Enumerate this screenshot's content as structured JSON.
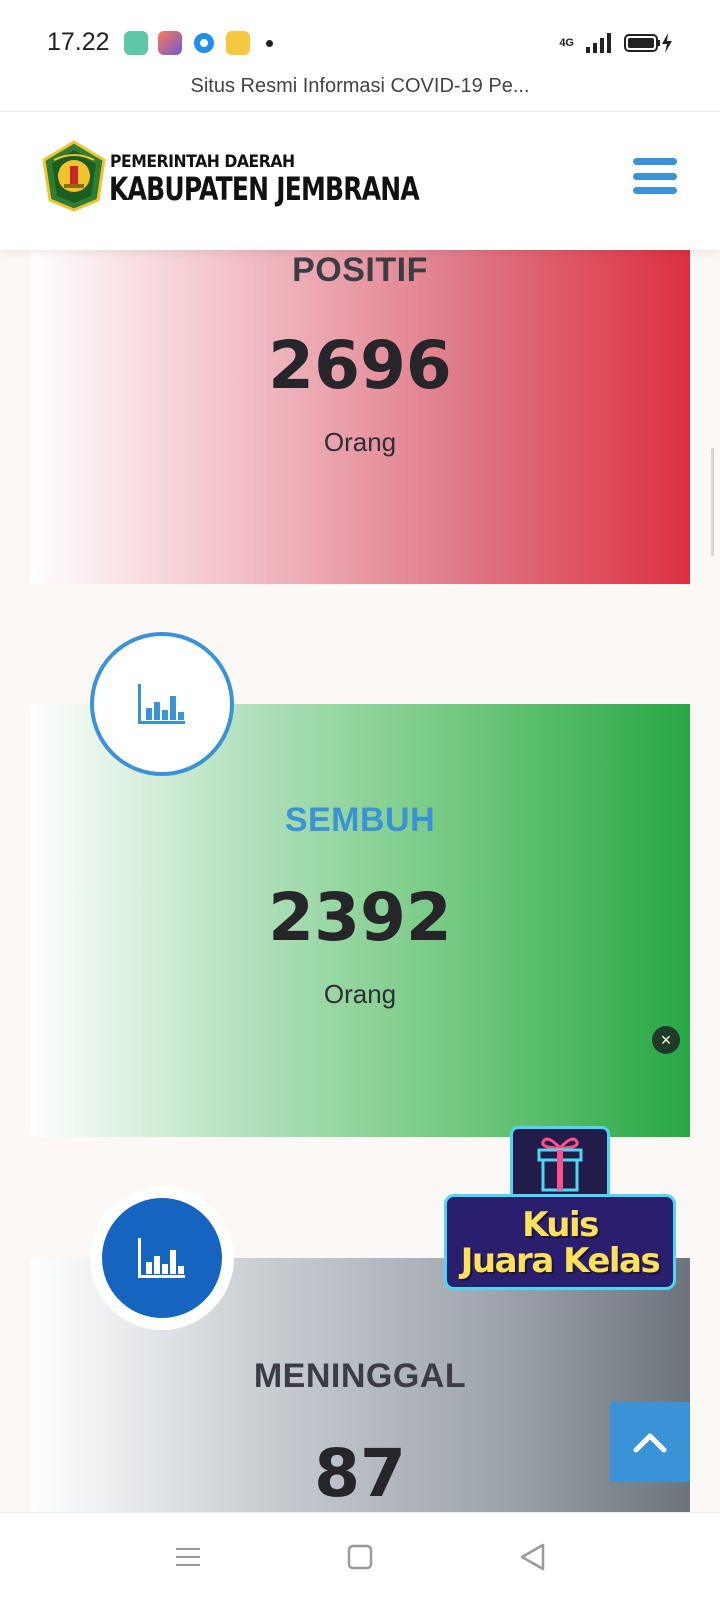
{
  "status_bar": {
    "time": "17.22",
    "network": "4G"
  },
  "browser": {
    "page_title": "Situs Resmi Informasi COVID-19 Pe..."
  },
  "header": {
    "org_line1": "PEMERINTAH DAERAH",
    "org_line2": "KABUPATEN JEMBRANA",
    "emblem_icon": "kabupaten-jembrana-emblem",
    "menu_icon": "hamburger-menu-icon",
    "menu_color": "#3a93d6"
  },
  "stats": {
    "positif": {
      "title": "POSITIF",
      "value": "2696",
      "unit": "Orang",
      "accent": "#dc3040"
    },
    "sembuh": {
      "title": "SEMBUH",
      "value": "2392",
      "unit": "Orang",
      "accent": "#28a745",
      "title_color": "#3a93d6"
    },
    "meninggal": {
      "title": "MENINGGAL",
      "value": "87",
      "accent": "#6c747c"
    },
    "icon": "bar-chart-icon"
  },
  "ad": {
    "line1": "Kuis",
    "line2": "Juara Kelas",
    "icon": "gift-icon",
    "close_label": "×"
  },
  "controls": {
    "back_to_top_icon": "chevron-up-icon",
    "back_to_top_color": "#3a93d6"
  },
  "nav": {
    "menu_icon": "recent-apps-icon",
    "home_icon": "home-square-icon",
    "back_icon": "back-triangle-icon"
  }
}
